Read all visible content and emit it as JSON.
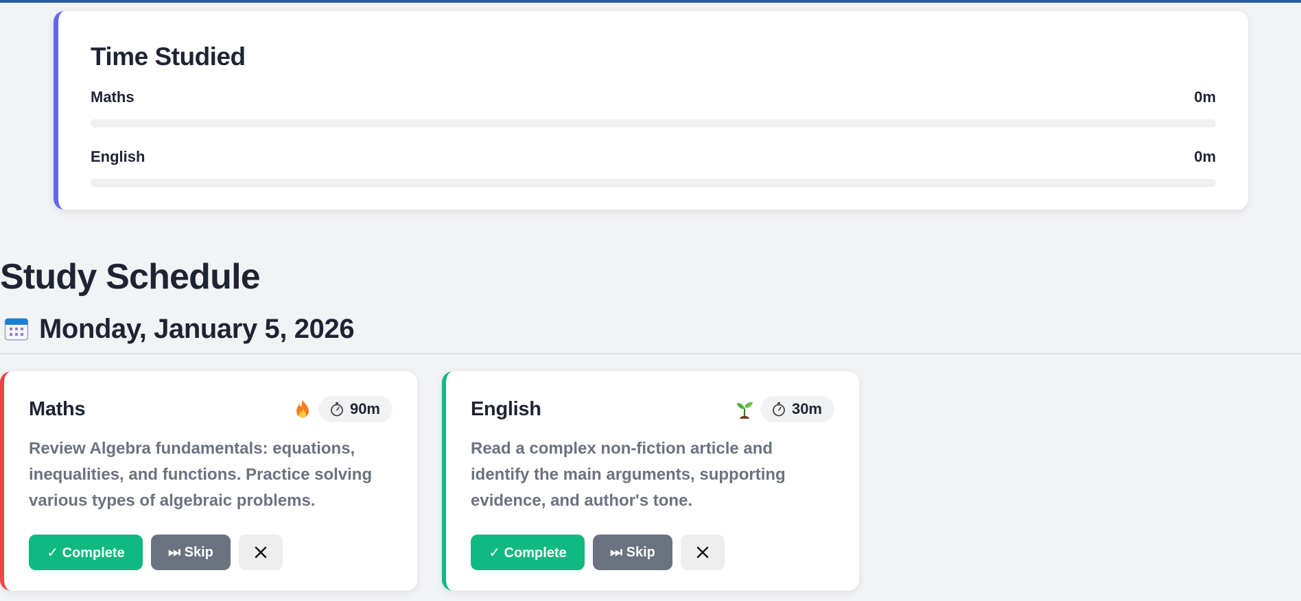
{
  "time_studied": {
    "title": "Time Studied",
    "accent": "#6366f1",
    "subjects": [
      {
        "name": "Maths",
        "time": "0m",
        "progress": 0
      },
      {
        "name": "English",
        "time": "0m",
        "progress": 0
      }
    ]
  },
  "schedule": {
    "title": "Study Schedule",
    "date_icon": "calendar-icon",
    "date": "Monday, January 5, 2026",
    "tasks": [
      {
        "subject": "Maths",
        "accent": "#ef4444",
        "priority_icon": "fire-icon",
        "duration": "90m",
        "description": "Review Algebra fundamentals: equations, inequalities, and functions. Practice solving various types of algebraic problems.",
        "complete_label": "✓ Complete",
        "skip_label": "⏭ Skip",
        "remove_icon": "close-icon"
      },
      {
        "subject": "English",
        "accent": "#10b981",
        "priority_icon": "seedling-icon",
        "duration": "30m",
        "description": "Read a complex non-fiction article and identify the main arguments, supporting evidence, and author's tone.",
        "complete_label": "✓ Complete",
        "skip_label": "⏭ Skip",
        "remove_icon": "close-icon"
      }
    ]
  },
  "colors": {
    "header_bar": "#2b5a9e",
    "complete": "#10b981",
    "skip": "#6b7280"
  }
}
